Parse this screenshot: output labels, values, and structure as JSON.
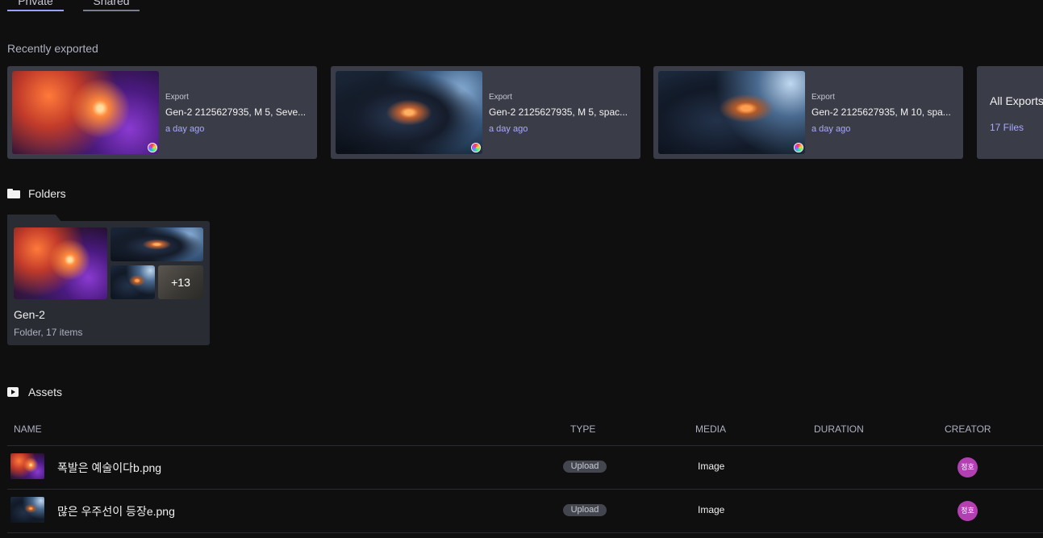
{
  "tabs": [
    {
      "label": "Private"
    },
    {
      "label": "Shared"
    }
  ],
  "recent": {
    "title": "Recently exported",
    "cards": [
      {
        "label": "Export",
        "name": "Gen-2 2125627935, M 5, Seve...",
        "time": "a day ago"
      },
      {
        "label": "Export",
        "name": "Gen-2 2125627935, M 5, spac...",
        "time": "a day ago"
      },
      {
        "label": "Export",
        "name": "Gen-2 2125627935, M 10, spa...",
        "time": "a day ago"
      }
    ],
    "all": {
      "title": "All Exports",
      "count": "17 Files"
    }
  },
  "folders": {
    "title": "Folders",
    "items": [
      {
        "name": "Gen-2",
        "info": "Folder, 17 items",
        "more": "+13"
      }
    ]
  },
  "assets": {
    "title": "Assets",
    "columns": {
      "name": "NAME",
      "type": "TYPE",
      "media": "MEDIA",
      "duration": "DURATION",
      "creator": "CREATOR"
    },
    "rows": [
      {
        "name": "폭발은 예술이다b.png",
        "type": "Upload",
        "media": "Image",
        "duration": "",
        "creator": "정호"
      },
      {
        "name": "많은 우주선이 등장e.png",
        "type": "Upload",
        "media": "Image",
        "duration": "",
        "creator": "정호"
      }
    ]
  },
  "colors": {
    "accent": "#a9aaff",
    "card": "#3a3d47",
    "avatar": "#b33fb3"
  }
}
